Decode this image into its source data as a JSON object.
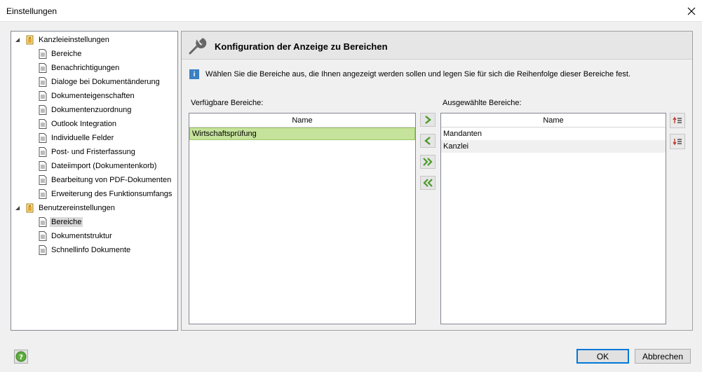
{
  "window": {
    "title": "Einstellungen"
  },
  "tree": {
    "group1": {
      "label": "Kanzleieinstellungen"
    },
    "group1_items": [
      "Bereiche",
      "Benachrichtigungen",
      "Dialoge bei Dokumentänderung",
      "Dokumenteigenschaften",
      "Dokumentenzuordnung",
      "Outlook Integration",
      "Individuelle Felder",
      "Post- und Fristerfassung",
      "Dateiimport (Dokumentenkorb)",
      "Bearbeitung von PDF-Dokumenten",
      "Erweiterung des Funktionsumfangs"
    ],
    "group2": {
      "label": "Benutzereinstellungen"
    },
    "group2_items": [
      "Bereiche",
      "Dokumentstruktur",
      "Schnellinfo Dokumente"
    ]
  },
  "panel": {
    "title": "Konfiguration der Anzeige zu Bereichen",
    "info": "Wählen Sie die Bereiche aus, die Ihnen angezeigt werden sollen und legen Sie für sich die Reihenfolge dieser Bereiche fest.",
    "available": {
      "caption": "Verfügbare Bereiche:",
      "header": "Name",
      "rows": [
        "Wirtschaftsprüfung"
      ]
    },
    "selected": {
      "caption": "Ausgewählte Bereiche:",
      "header": "Name",
      "rows": [
        "Mandanten",
        "Kanzlei"
      ]
    }
  },
  "buttons": {
    "ok": "OK",
    "cancel": "Abbrechen"
  },
  "colors": {
    "selection_green": "#c5e39b",
    "accent_blue": "#0078d7",
    "arrow_green": "#4a9a2a"
  }
}
